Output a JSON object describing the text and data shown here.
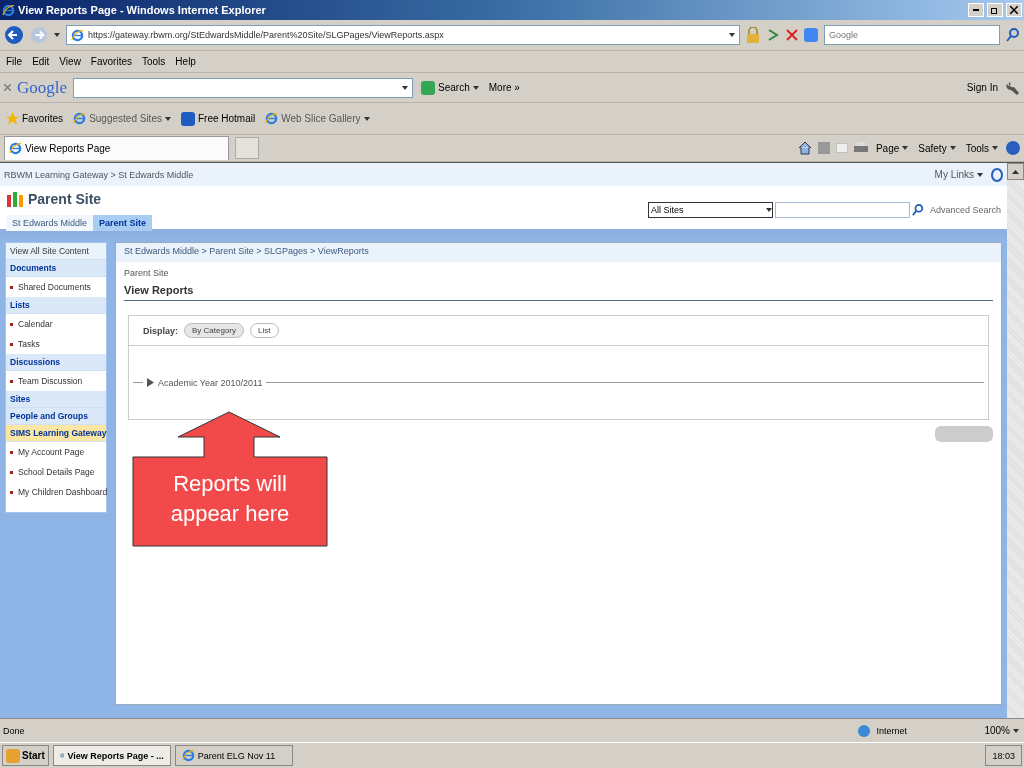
{
  "window": {
    "title": "View Reports Page - Windows Internet Explorer"
  },
  "address_bar": {
    "url": "https://gateway.rbwm.org/StEdwardsMiddle/Parent%20Site/SLGPages/ViewReports.aspx"
  },
  "search_box": {
    "placeholder": "Google"
  },
  "menu": [
    "File",
    "Edit",
    "View",
    "Favorites",
    "Tools",
    "Help"
  ],
  "google_toolbar": {
    "logo": "Google",
    "search": "Search",
    "more": "More »",
    "sign_in": "Sign In"
  },
  "favorites_bar": [
    {
      "label": "Favorites",
      "kind": "favorites"
    },
    {
      "label": "Suggested Sites",
      "kind": "menu"
    },
    {
      "label": "Free Hotmail",
      "kind": "link"
    },
    {
      "label": "Web Slice Gallery",
      "kind": "menu"
    }
  ],
  "browser_tab": {
    "title": "View Reports Page"
  },
  "command_bar": [
    "Page",
    "Safety",
    "Tools"
  ],
  "page": {
    "top_breadcrumb": "RBWM Learning Gateway > St Edwards Middle",
    "my_links": "My Links",
    "site_title": "Parent Site",
    "site_tabs": [
      {
        "label": "St Edwards Middle",
        "selected": false
      },
      {
        "label": "Parent Site",
        "selected": true
      }
    ],
    "search_scope": "All Sites",
    "advanced_search": "Advanced Search",
    "quick_launch": [
      {
        "label": "View All Site Content",
        "kind": "top"
      },
      {
        "label": "Documents",
        "kind": "heading"
      },
      {
        "label": "Shared Documents",
        "kind": "link"
      },
      {
        "label": "Lists",
        "kind": "heading"
      },
      {
        "label": "Calendar",
        "kind": "link"
      },
      {
        "label": "Tasks",
        "kind": "link"
      },
      {
        "label": "Discussions",
        "kind": "heading"
      },
      {
        "label": "Team Discussion",
        "kind": "link"
      },
      {
        "label": "Sites",
        "kind": "heading"
      },
      {
        "label": "People and Groups",
        "kind": "heading"
      },
      {
        "label": "SIMS Learning Gateway",
        "kind": "highlight"
      },
      {
        "label": "My Account Page",
        "kind": "link"
      },
      {
        "label": "School Details Page",
        "kind": "link"
      },
      {
        "label": "My Children Dashboard",
        "kind": "link"
      }
    ],
    "breadcrumb": "St Edwards Middle > Parent Site > SLGPages > ViewReports",
    "page_parent": "Parent Site",
    "page_title": "View Reports",
    "display_label": "Display:",
    "display_options": [
      {
        "label": "By Category",
        "selected": true
      },
      {
        "label": "List",
        "selected": false
      }
    ],
    "category": "Academic Year 2010/2011",
    "callout": "Reports will appear here"
  },
  "status_bar": {
    "text": "Done",
    "zone": "Internet",
    "zoom": "100%"
  },
  "taskbar": {
    "start": "Start",
    "items": [
      {
        "label": "View Reports Page - ...",
        "selected": true
      },
      {
        "label": "Parent ELG Nov 11",
        "selected": false
      }
    ],
    "clock": "18:03"
  }
}
